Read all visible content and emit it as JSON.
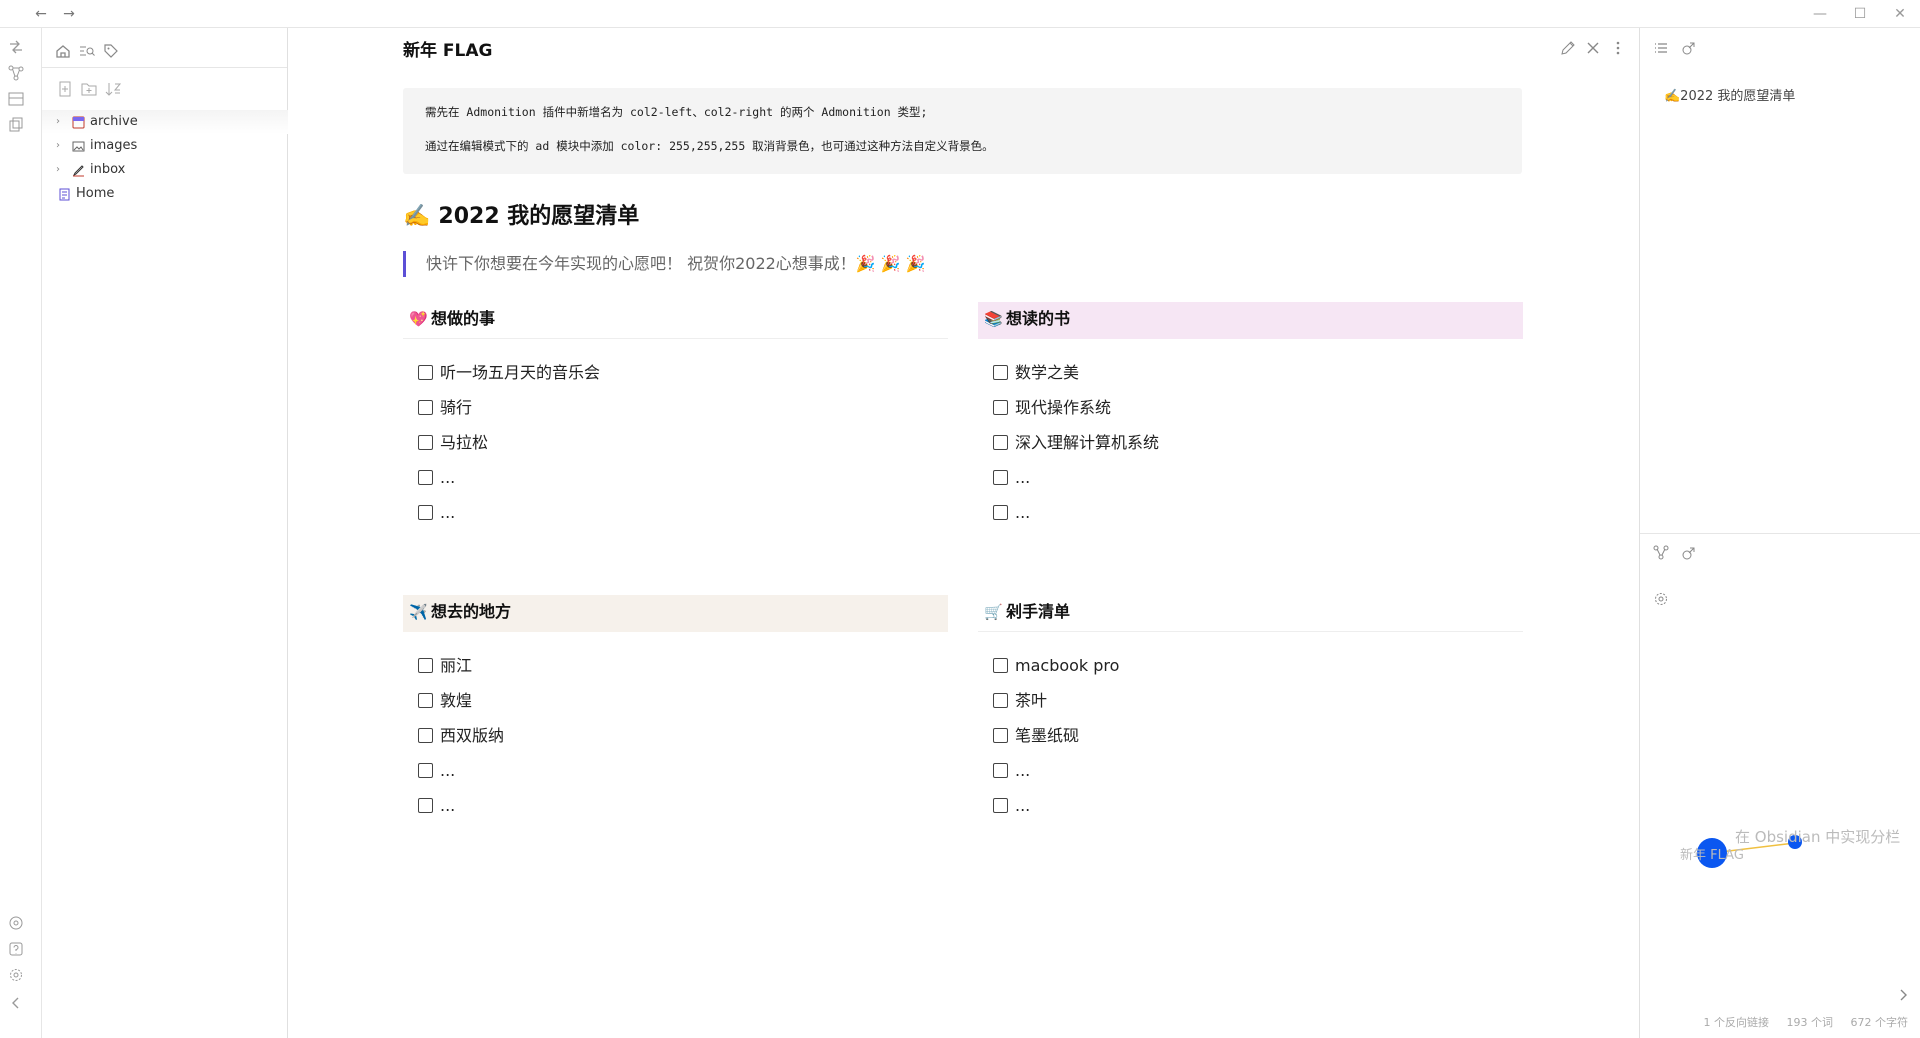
{
  "window": {
    "nav_back": "←",
    "nav_forward": "→",
    "minimize": "—",
    "maximize": "☐",
    "close": "✕"
  },
  "explorer": {
    "tree": [
      {
        "label": "archive",
        "icon": "archive-folder-icon",
        "expandable": true
      },
      {
        "label": "images",
        "icon": "image-folder-icon",
        "expandable": true
      },
      {
        "label": "inbox",
        "icon": "pen-folder-icon",
        "expandable": true
      },
      {
        "label": "Home",
        "icon": "note-icon",
        "expandable": false
      }
    ]
  },
  "doc": {
    "title": "新年 FLAG",
    "admonition_lines": [
      "需先在 Admonition 插件中新增名为 col2-left、col2-right 的两个 Admonition 类型;",
      "通过在编辑模式下的 ad 模块中添加 color: 255,255,255 取消背景色，也可通过这种方法自定义背景色。"
    ],
    "heading_emoji": "✍️",
    "heading": "2022 我的愿望清单",
    "quote": "快许下你想要在今年实现的心愿吧！ 祝贺你2022心想事成！🎉 🎉 🎉",
    "columns": [
      {
        "emoji": "💖",
        "title": "想做的事",
        "style": "plain",
        "tasks": [
          "听一场五月天的音乐会",
          "骑行",
          "马拉松",
          "...",
          "..."
        ]
      },
      {
        "emoji": "📚",
        "title": "想读的书",
        "style": "pink",
        "tasks": [
          "数学之美",
          "现代操作系统",
          "深入理解计算机系统",
          "...",
          "..."
        ]
      },
      {
        "emoji": "✈️",
        "title": "想去的地方",
        "style": "beige",
        "tasks": [
          "丽江",
          "敦煌",
          "西双版纳",
          "...",
          "..."
        ]
      },
      {
        "emoji": "🛒",
        "title": "剁手清单",
        "style": "plain",
        "tasks": [
          "macbook pro",
          "茶叶",
          "笔墨纸砚",
          "...",
          "..."
        ]
      }
    ]
  },
  "right_sidebar": {
    "outline_item": "✍️2022 我的愿望清单",
    "graph": {
      "node_current": "新年 FLAG",
      "node_linked": "在 Obsidian 中实现分栏",
      "node_color": "#0b57f0",
      "link_color": "#f0c040"
    },
    "status": {
      "backlinks": "1 个反向链接",
      "words": "193 个词",
      "chars": "672 个字符"
    }
  },
  "colors": {
    "accent": "#5c4fd6",
    "pink_header": "#f6e6f4",
    "beige_header": "#f6f1eb"
  }
}
